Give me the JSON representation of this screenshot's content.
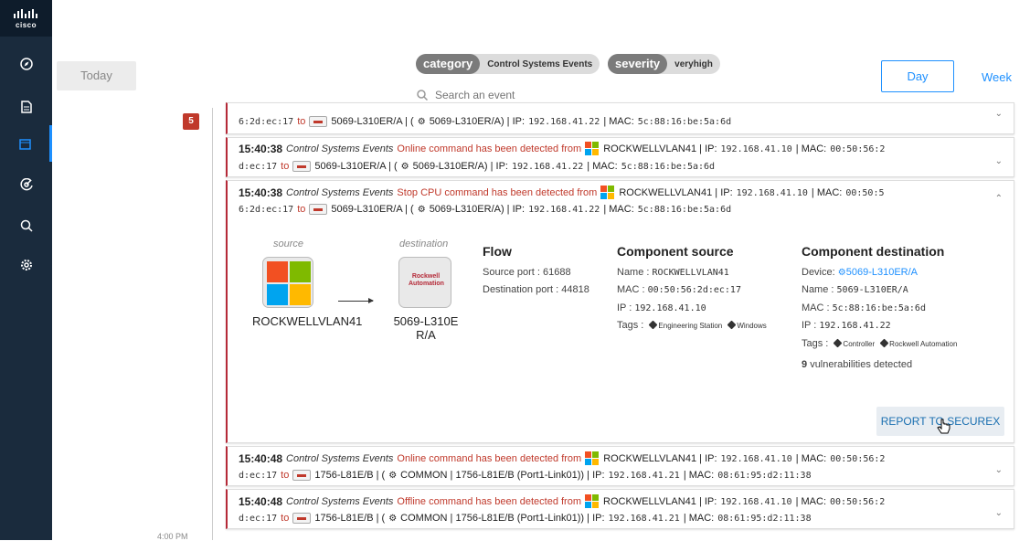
{
  "nav": {
    "logo_text": "cisco",
    "icons": [
      "compass-icon",
      "document-icon",
      "calendar-icon",
      "radar-icon",
      "search-icon",
      "settings-icon"
    ]
  },
  "header": {
    "today_label": "Today",
    "filters": [
      {
        "key": "category",
        "value": "Control Systems Events"
      },
      {
        "key": "severity",
        "value": "veryhigh"
      }
    ],
    "search_placeholder": "Search an event",
    "day_label": "Day",
    "week_label": "Week"
  },
  "timeline": {
    "count": "5",
    "time_label": "4:00 PM"
  },
  "events": [
    {
      "line1": "",
      "line2_prefix": "6:2d:ec:17",
      "to": "to",
      "dest": "5069-L310ER/A | (",
      "dest_inner": "5069-L310ER/A) | IP:",
      "dest_ip": "192.168.41.22",
      "dest_mac_label": "| MAC:",
      "dest_mac": "5c:88:16:be:5a:6d"
    },
    {
      "time": "15:40:38",
      "category": "Control Systems Events",
      "message": "Online command has been detected from",
      "src": "ROCKWELLVLAN41 | IP:",
      "src_ip": "192.168.41.10",
      "src_mac_label": "| MAC:",
      "src_mac": "00:50:56:2",
      "line2_prefix": "d:ec:17",
      "to": "to",
      "dest": "5069-L310ER/A | (",
      "dest_inner": "5069-L310ER/A) | IP:",
      "dest_ip": "192.168.41.22",
      "dest_mac_label": "| MAC:",
      "dest_mac": "5c:88:16:be:5a:6d"
    },
    {
      "time": "15:40:38",
      "category": "Control Systems Events",
      "message": "Stop CPU command has been detected from",
      "src": "ROCKWELLVLAN41 | IP:",
      "src_ip": "192.168.41.10",
      "src_mac_label": "| MAC:",
      "src_mac": "00:50:5",
      "line2_prefix": "6:2d:ec:17",
      "to": "to",
      "dest": "5069-L310ER/A | (",
      "dest_inner": "5069-L310ER/A) | IP:",
      "dest_ip": "192.168.41.22",
      "dest_mac_label": "| MAC:",
      "dest_mac": "5c:88:16:be:5a:6d",
      "detail": {
        "source_label": "source",
        "destination_label": "destination",
        "source_name": "ROCKWELLVLAN41",
        "destination_name_1": "5069-L310E",
        "destination_name_2": "R/A",
        "rockwell_logo_1": "Rockwell",
        "rockwell_logo_2": "Automation",
        "flow": {
          "title": "Flow",
          "source_port_label": "Source port :",
          "source_port": "61688",
          "destination_port_label": "Destination port :",
          "destination_port": "44818"
        },
        "component_source": {
          "title": "Component source",
          "name_label": "Name :",
          "name": "ROCKWELLVLAN41",
          "mac_label": "MAC :",
          "mac": "00:50:56:2d:ec:17",
          "ip_label": "IP :",
          "ip": "192.168.41.10",
          "tags_label": "Tags :",
          "tags": [
            "Engineering Station",
            "Windows"
          ]
        },
        "component_destination": {
          "title": "Component destination",
          "device_label": "Device:",
          "device": "5069-L310ER/A",
          "name_label": "Name :",
          "name": "5069-L310ER/A",
          "mac_label": "MAC :",
          "mac": "5c:88:16:be:5a:6d",
          "ip_label": "IP :",
          "ip": "192.168.41.22",
          "tags_label": "Tags :",
          "tags": [
            "Controller",
            "Rockwell Automation"
          ],
          "vuln_count": "9",
          "vuln_text": "vulnerabilities detected"
        },
        "report_label": "REPORT TO SECUREX"
      }
    },
    {
      "time": "15:40:48",
      "category": "Control Systems Events",
      "message": "Online command has been detected from",
      "src": "ROCKWELLVLAN41 | IP:",
      "src_ip": "192.168.41.10",
      "src_mac_label": "| MAC:",
      "src_mac": "00:50:56:2",
      "line2_prefix": "d:ec:17",
      "to": "to",
      "dest": "1756-L81E/B | (",
      "dest_inner": "COMMON | 1756-L81E/B (Port1-Link01)) | IP:",
      "dest_ip": "192.168.41.21",
      "dest_mac_label": "| MAC:",
      "dest_mac": "08:61:95:d2:11:38"
    },
    {
      "time": "15:40:48",
      "category": "Control Systems Events",
      "message": "Offline command has been detected from",
      "src": "ROCKWELLVLAN41 | IP:",
      "src_ip": "192.168.41.10",
      "src_mac_label": "| MAC:",
      "src_mac": "00:50:56:2",
      "line2_prefix": "d:ec:17",
      "to": "to",
      "dest": "1756-L81E/B | (",
      "dest_inner": "COMMON | 1756-L81E/B (Port1-Link01)) | IP:",
      "dest_ip": "192.168.41.21",
      "dest_mac_label": "| MAC:",
      "dest_mac": "08:61:95:d2:11:38"
    }
  ]
}
